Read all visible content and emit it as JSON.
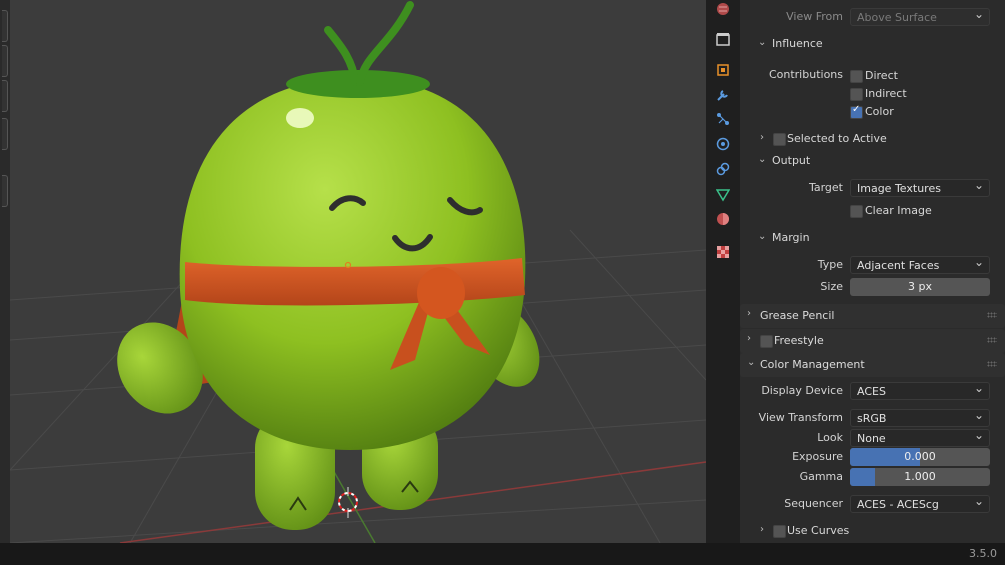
{
  "properties": {
    "view_from": {
      "label": "View From",
      "value": "Above Surface"
    },
    "influence": {
      "title": "Influence",
      "contributions_label": "Contributions",
      "direct": "Direct",
      "indirect": "Indirect",
      "color": "Color",
      "selected_to_active": "Selected to Active"
    },
    "output": {
      "title": "Output",
      "target_label": "Target",
      "target_value": "Image Textures",
      "clear_image": "Clear Image"
    },
    "margin": {
      "title": "Margin",
      "type_label": "Type",
      "type_value": "Adjacent Faces",
      "size_label": "Size",
      "size_value": "3 px"
    },
    "grease_pencil": {
      "title": "Grease Pencil"
    },
    "freestyle": {
      "title": "Freestyle"
    },
    "color_management": {
      "title": "Color Management",
      "display_device_label": "Display Device",
      "display_device_value": "ACES",
      "view_transform_label": "View Transform",
      "view_transform_value": "sRGB",
      "look_label": "Look",
      "look_value": "None",
      "exposure_label": "Exposure",
      "exposure_value": "0.000",
      "exposure_fill": 0.5,
      "gamma_label": "Gamma",
      "gamma_value": "1.000",
      "gamma_fill": 0.18,
      "sequencer_label": "Sequencer",
      "sequencer_value": "ACES - ACEScg",
      "use_curves": "Use Curves"
    }
  },
  "status": {
    "version": "3.5.0"
  },
  "colors": {
    "accent": "#4772b3",
    "character": "#8ec021",
    "scarf": "#d4561f",
    "stem": "#3e8f1f"
  },
  "tab_icons": [
    "world-icon",
    "collection-icon",
    "object-icon",
    "modifier-icon",
    "particles-icon",
    "physics-icon",
    "constraints-icon",
    "data-icon",
    "material-icon",
    "texture-icon"
  ]
}
